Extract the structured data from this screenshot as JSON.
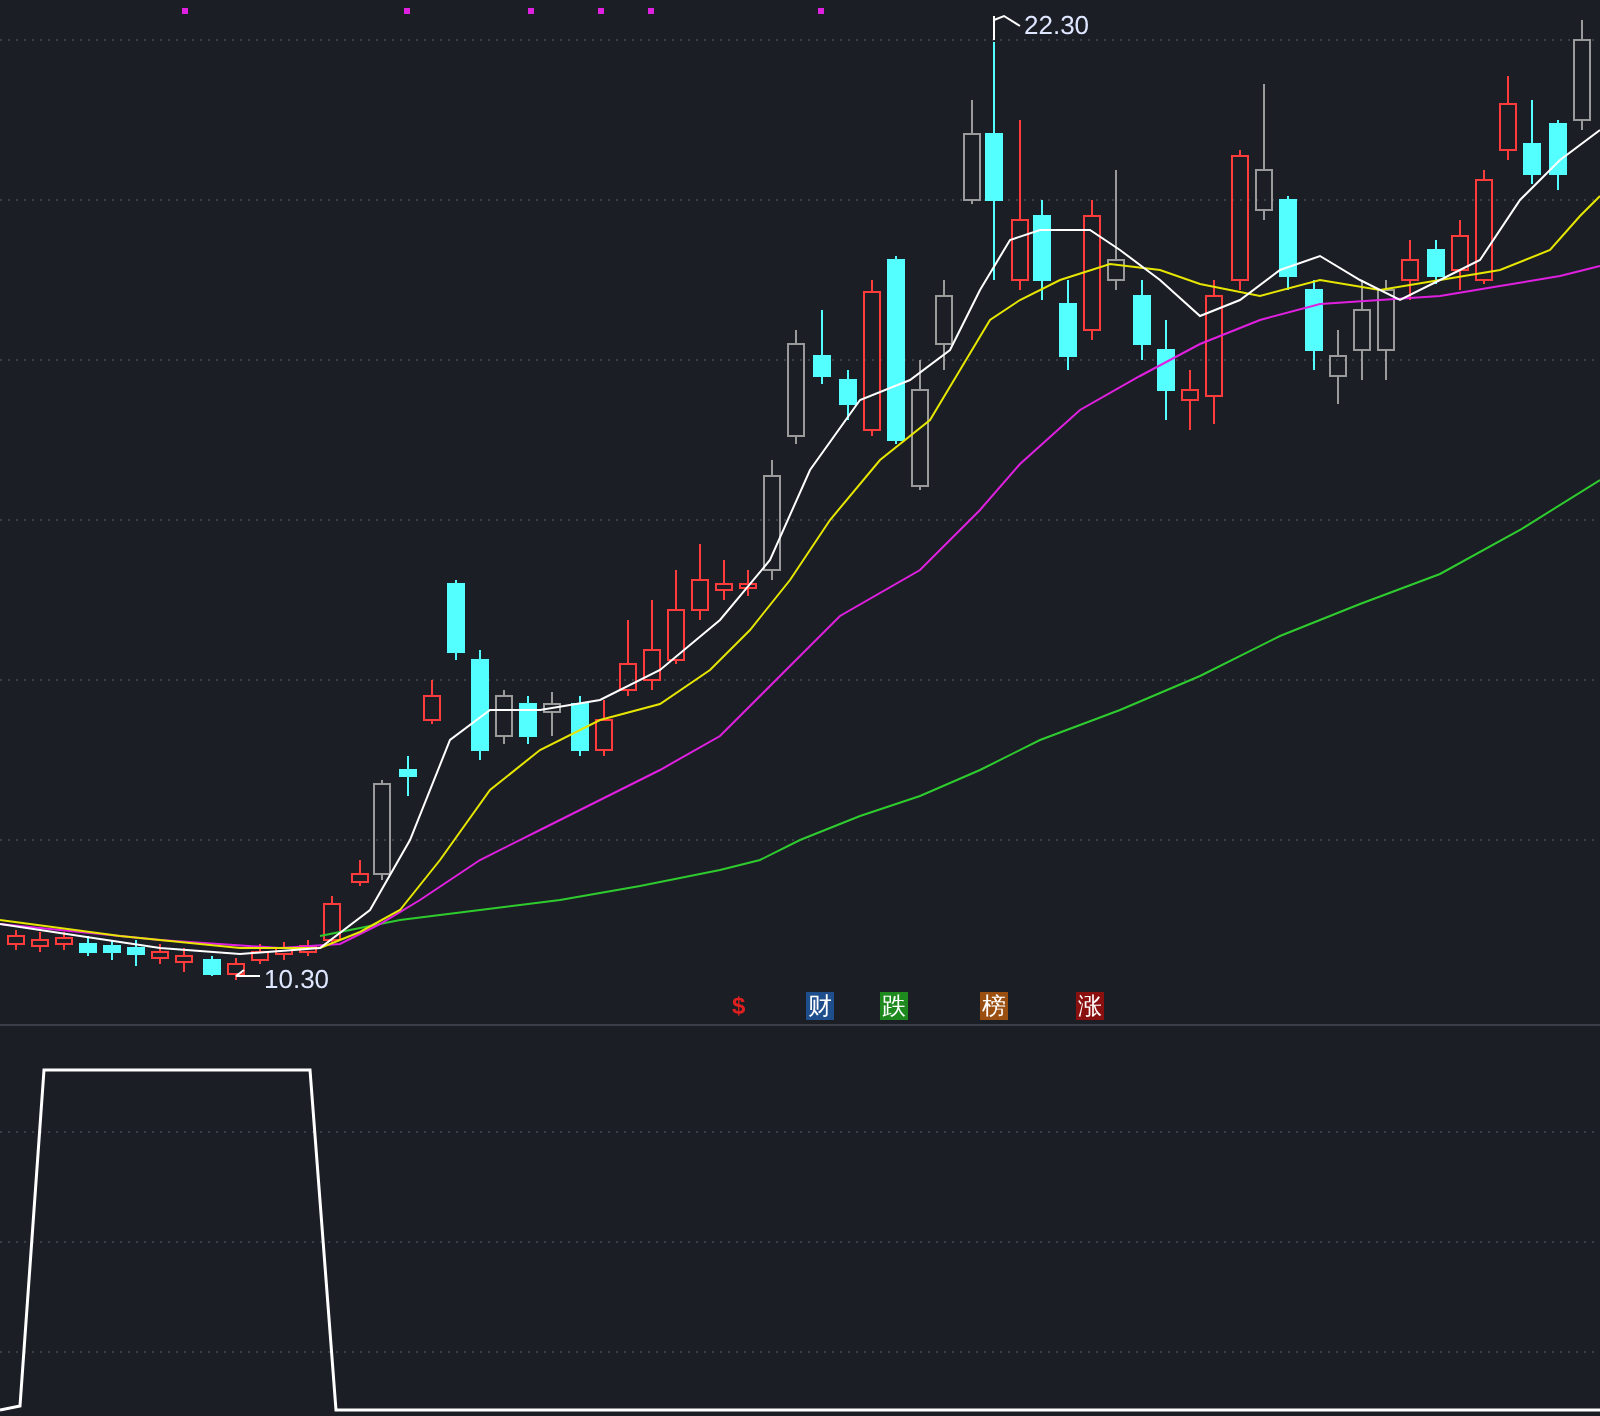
{
  "price_labels": {
    "high": "22.30",
    "low": "10.30"
  },
  "signal_markers": [
    {
      "text": "$",
      "kind": "text",
      "color": "#e02020"
    },
    {
      "text": "财",
      "kind": "badge",
      "color": "#1f4e8c"
    },
    {
      "text": "跌",
      "kind": "badge",
      "color": "#1e8a1e"
    },
    {
      "text": "榜",
      "kind": "badge",
      "color": "#9a4e10"
    },
    {
      "text": "涨",
      "kind": "badge",
      "color": "#8a1010"
    }
  ]
}
